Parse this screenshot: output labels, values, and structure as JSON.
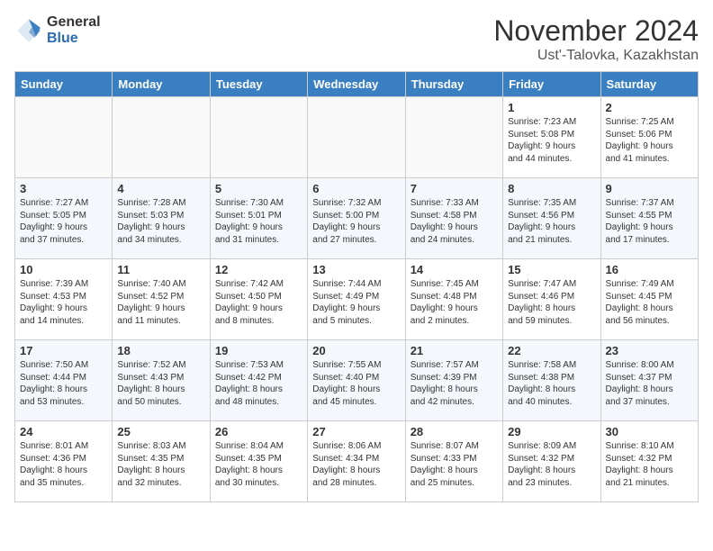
{
  "logo": {
    "general": "General",
    "blue": "Blue"
  },
  "header": {
    "month": "November 2024",
    "location": "Ust'-Talovka, Kazakhstan"
  },
  "weekdays": [
    "Sunday",
    "Monday",
    "Tuesday",
    "Wednesday",
    "Thursday",
    "Friday",
    "Saturday"
  ],
  "weeks": [
    [
      {
        "day": "",
        "info": ""
      },
      {
        "day": "",
        "info": ""
      },
      {
        "day": "",
        "info": ""
      },
      {
        "day": "",
        "info": ""
      },
      {
        "day": "",
        "info": ""
      },
      {
        "day": "1",
        "info": "Sunrise: 7:23 AM\nSunset: 5:08 PM\nDaylight: 9 hours\nand 44 minutes."
      },
      {
        "day": "2",
        "info": "Sunrise: 7:25 AM\nSunset: 5:06 PM\nDaylight: 9 hours\nand 41 minutes."
      }
    ],
    [
      {
        "day": "3",
        "info": "Sunrise: 7:27 AM\nSunset: 5:05 PM\nDaylight: 9 hours\nand 37 minutes."
      },
      {
        "day": "4",
        "info": "Sunrise: 7:28 AM\nSunset: 5:03 PM\nDaylight: 9 hours\nand 34 minutes."
      },
      {
        "day": "5",
        "info": "Sunrise: 7:30 AM\nSunset: 5:01 PM\nDaylight: 9 hours\nand 31 minutes."
      },
      {
        "day": "6",
        "info": "Sunrise: 7:32 AM\nSunset: 5:00 PM\nDaylight: 9 hours\nand 27 minutes."
      },
      {
        "day": "7",
        "info": "Sunrise: 7:33 AM\nSunset: 4:58 PM\nDaylight: 9 hours\nand 24 minutes."
      },
      {
        "day": "8",
        "info": "Sunrise: 7:35 AM\nSunset: 4:56 PM\nDaylight: 9 hours\nand 21 minutes."
      },
      {
        "day": "9",
        "info": "Sunrise: 7:37 AM\nSunset: 4:55 PM\nDaylight: 9 hours\nand 17 minutes."
      }
    ],
    [
      {
        "day": "10",
        "info": "Sunrise: 7:39 AM\nSunset: 4:53 PM\nDaylight: 9 hours\nand 14 minutes."
      },
      {
        "day": "11",
        "info": "Sunrise: 7:40 AM\nSunset: 4:52 PM\nDaylight: 9 hours\nand 11 minutes."
      },
      {
        "day": "12",
        "info": "Sunrise: 7:42 AM\nSunset: 4:50 PM\nDaylight: 9 hours\nand 8 minutes."
      },
      {
        "day": "13",
        "info": "Sunrise: 7:44 AM\nSunset: 4:49 PM\nDaylight: 9 hours\nand 5 minutes."
      },
      {
        "day": "14",
        "info": "Sunrise: 7:45 AM\nSunset: 4:48 PM\nDaylight: 9 hours\nand 2 minutes."
      },
      {
        "day": "15",
        "info": "Sunrise: 7:47 AM\nSunset: 4:46 PM\nDaylight: 8 hours\nand 59 minutes."
      },
      {
        "day": "16",
        "info": "Sunrise: 7:49 AM\nSunset: 4:45 PM\nDaylight: 8 hours\nand 56 minutes."
      }
    ],
    [
      {
        "day": "17",
        "info": "Sunrise: 7:50 AM\nSunset: 4:44 PM\nDaylight: 8 hours\nand 53 minutes."
      },
      {
        "day": "18",
        "info": "Sunrise: 7:52 AM\nSunset: 4:43 PM\nDaylight: 8 hours\nand 50 minutes."
      },
      {
        "day": "19",
        "info": "Sunrise: 7:53 AM\nSunset: 4:42 PM\nDaylight: 8 hours\nand 48 minutes."
      },
      {
        "day": "20",
        "info": "Sunrise: 7:55 AM\nSunset: 4:40 PM\nDaylight: 8 hours\nand 45 minutes."
      },
      {
        "day": "21",
        "info": "Sunrise: 7:57 AM\nSunset: 4:39 PM\nDaylight: 8 hours\nand 42 minutes."
      },
      {
        "day": "22",
        "info": "Sunrise: 7:58 AM\nSunset: 4:38 PM\nDaylight: 8 hours\nand 40 minutes."
      },
      {
        "day": "23",
        "info": "Sunrise: 8:00 AM\nSunset: 4:37 PM\nDaylight: 8 hours\nand 37 minutes."
      }
    ],
    [
      {
        "day": "24",
        "info": "Sunrise: 8:01 AM\nSunset: 4:36 PM\nDaylight: 8 hours\nand 35 minutes."
      },
      {
        "day": "25",
        "info": "Sunrise: 8:03 AM\nSunset: 4:35 PM\nDaylight: 8 hours\nand 32 minutes."
      },
      {
        "day": "26",
        "info": "Sunrise: 8:04 AM\nSunset: 4:35 PM\nDaylight: 8 hours\nand 30 minutes."
      },
      {
        "day": "27",
        "info": "Sunrise: 8:06 AM\nSunset: 4:34 PM\nDaylight: 8 hours\nand 28 minutes."
      },
      {
        "day": "28",
        "info": "Sunrise: 8:07 AM\nSunset: 4:33 PM\nDaylight: 8 hours\nand 25 minutes."
      },
      {
        "day": "29",
        "info": "Sunrise: 8:09 AM\nSunset: 4:32 PM\nDaylight: 8 hours\nand 23 minutes."
      },
      {
        "day": "30",
        "info": "Sunrise: 8:10 AM\nSunset: 4:32 PM\nDaylight: 8 hours\nand 21 minutes."
      }
    ]
  ]
}
